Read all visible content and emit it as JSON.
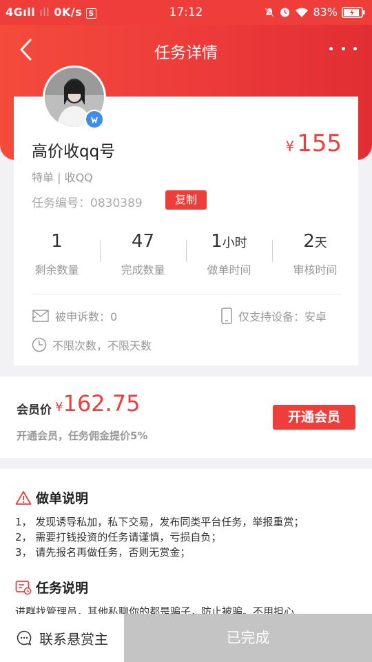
{
  "status_bar": {
    "network": "4G",
    "speed": "0K/s",
    "time": "17:12",
    "battery": "83%"
  },
  "header": {
    "title": "任务详情"
  },
  "task": {
    "name": "高价收qq号",
    "price_symbol": "¥",
    "price": "155",
    "tags": "特单 | 收QQ",
    "task_no": "任务编号：0830389",
    "copy_label": "复制",
    "stats": [
      {
        "value": "1",
        "unit": "",
        "label": "剩余数量"
      },
      {
        "value": "47",
        "unit": "",
        "label": "完成数量"
      },
      {
        "value": "1",
        "unit": "小时",
        "label": "做单时间"
      },
      {
        "value": "2",
        "unit": "天",
        "label": "审核时间"
      }
    ],
    "complaints": "被申诉数：0",
    "device": "仅支持设备：安卓",
    "limit": "不限次数，不限天数"
  },
  "member": {
    "label": "会员价",
    "price_symbol": "¥",
    "price": "162.75",
    "note": "开通会员，任务佣金提价5%",
    "open_label": "开通会员"
  },
  "instructions": {
    "title": "做单说明",
    "rules": [
      "1， 发现诱导私加，私下交易，发布同类平台任务，举报重赏；",
      "2， 需要打钱投资的任务请谨慎，亏损自负；",
      "3， 请先报名再做任务，否则无赏金；"
    ]
  },
  "task_desc": {
    "title": "任务说明",
    "text": "进群找管理员，其他私聊你的都是骗子，防止被骗。不用担心"
  },
  "bottom": {
    "contact_label": "联系悬赏主",
    "done_label": "已完成"
  },
  "colors": {
    "accent": "#ef3d3a",
    "disabled": "#c4c4c4"
  }
}
